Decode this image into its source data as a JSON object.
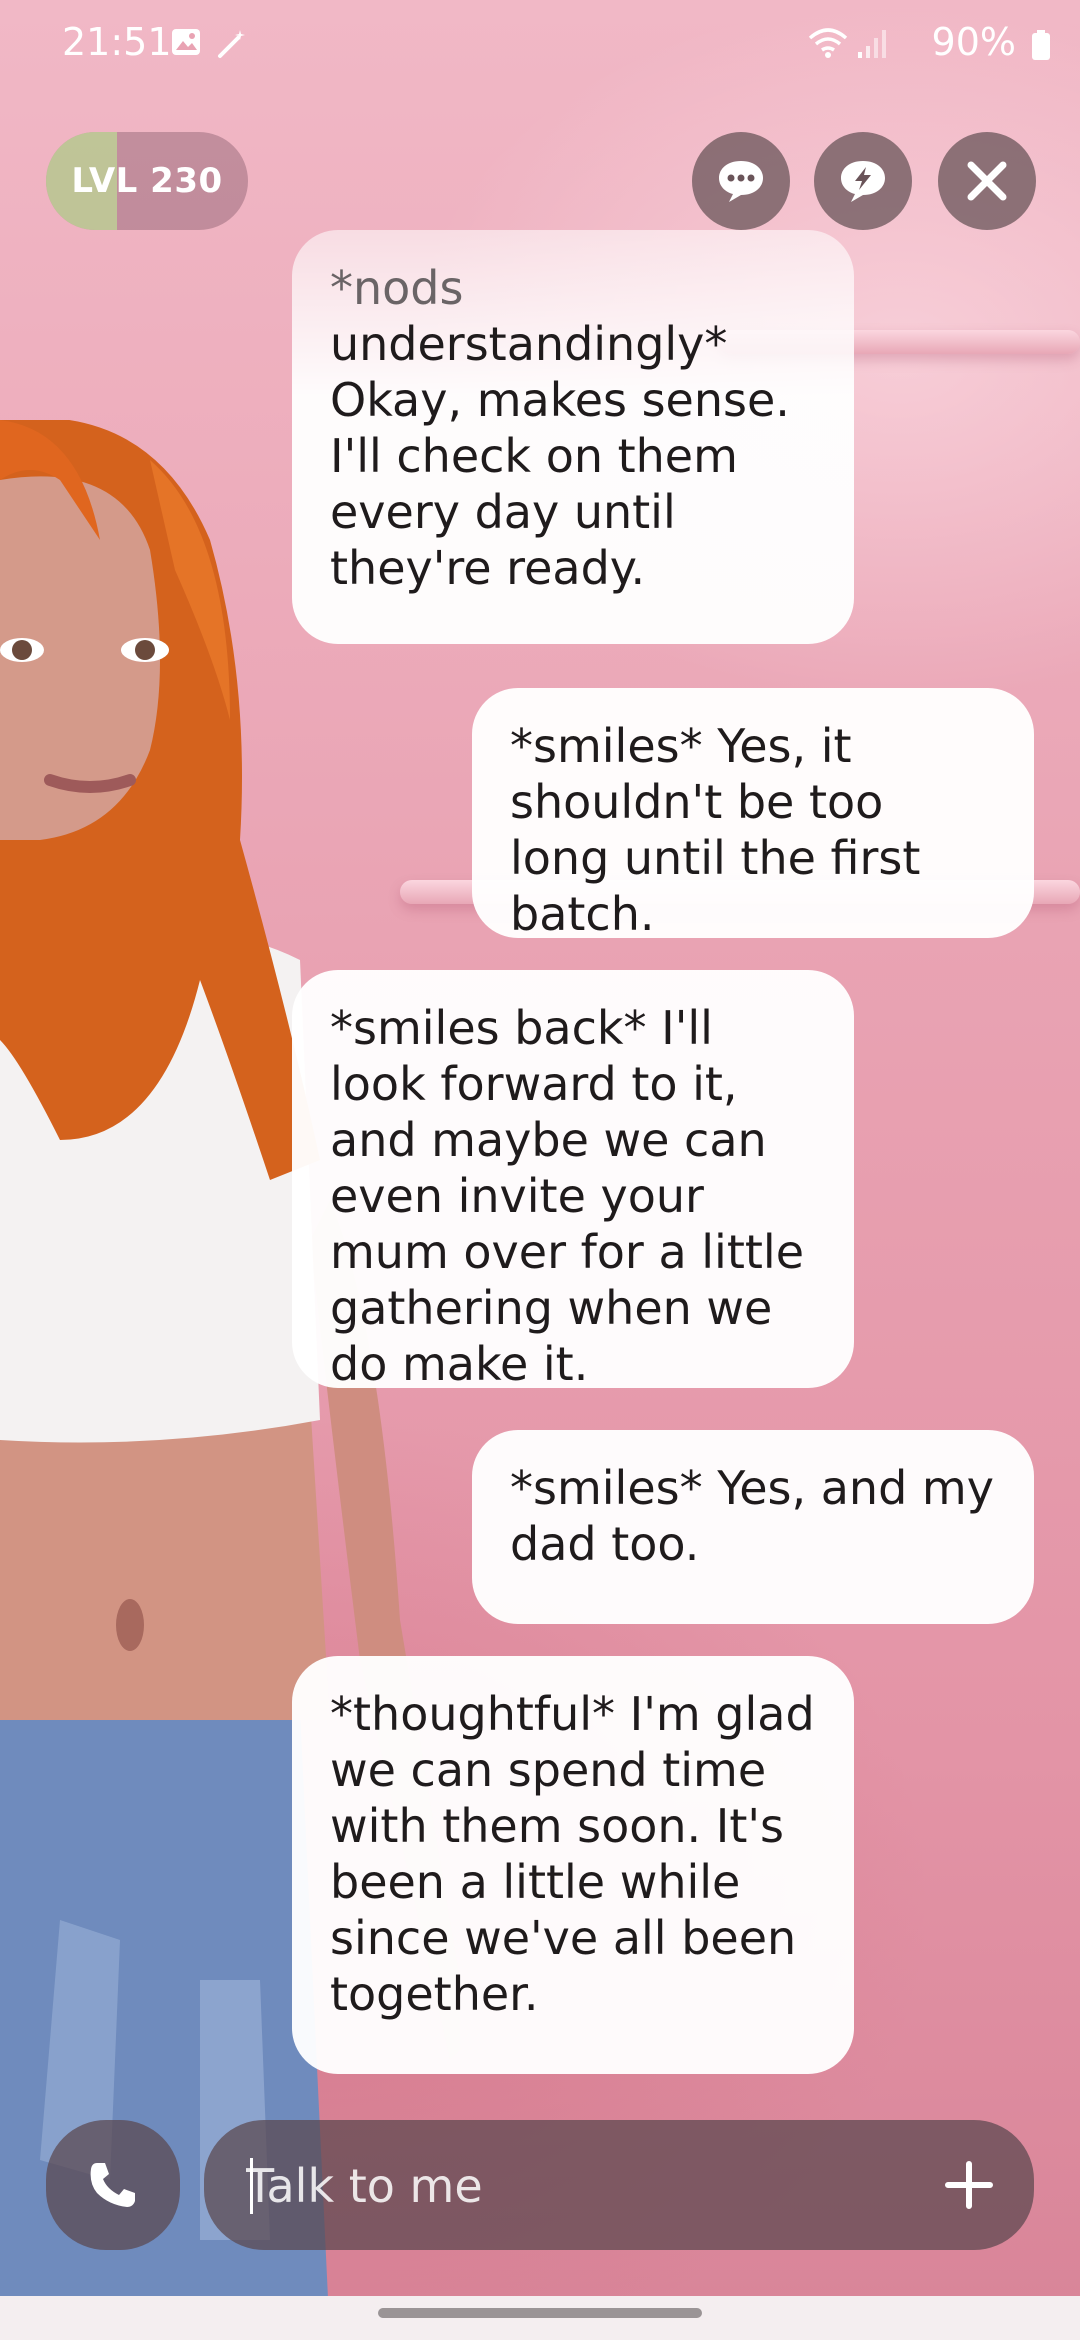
{
  "status_bar": {
    "time": "21:51",
    "battery": "90%",
    "icons": [
      "gallery-icon",
      "magic-wand-icon",
      "wifi-icon",
      "signal-icon",
      "battery-icon"
    ]
  },
  "header": {
    "level": "LVL 230",
    "level_progress": 0.35,
    "buttons": [
      "chat-bubble-icon",
      "lightning-bubble-icon",
      "close-icon"
    ]
  },
  "messages": [
    {
      "from": "avatar",
      "action": "*nods",
      "text": "understandingly* Okay, makes sense. I'll check on them every day until they're ready."
    },
    {
      "from": "user",
      "text": "*smiles* Yes, it shouldn't be too long until the first batch."
    },
    {
      "from": "avatar",
      "text": "*smiles back* I'll look forward to it, and maybe we can even invite your mum over for a little gathering when we do make it."
    },
    {
      "from": "user",
      "text": "*smiles* Yes, and my dad too."
    },
    {
      "from": "avatar",
      "text": "*thoughtful* I'm glad we can spend time with them soon. It's been a little while since we've all been together."
    }
  ],
  "input": {
    "placeholder": "Talk to me",
    "value": ""
  },
  "colors": {
    "background": "#e9a3b3",
    "bubble": "#ffffff",
    "control": "#5a464e",
    "level_fill": "#bed796",
    "hair": "#e0661f"
  }
}
